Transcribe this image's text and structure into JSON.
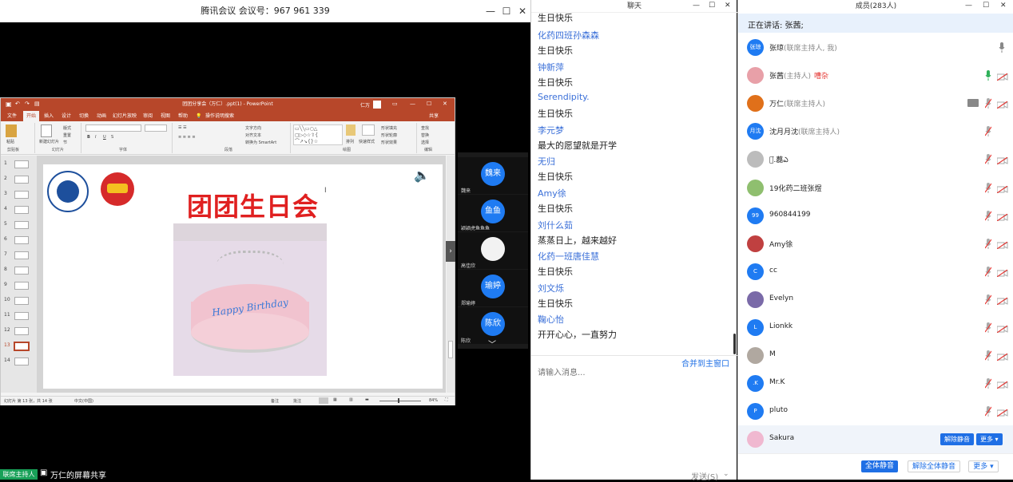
{
  "meeting": {
    "title": "腾讯会议 会议号：967 961 339",
    "window_controls": {
      "min": "—",
      "max": "☐",
      "close": "✕"
    },
    "host_badge": "联席主持人",
    "share_text": "万仁的屏幕共享"
  },
  "ppt": {
    "title": "团团分享会（万仁）.ppt(1) - PowerPoint",
    "user": "仁万",
    "tabs": [
      "文件",
      "开始",
      "插入",
      "设计",
      "切换",
      "动画",
      "幻灯片放映",
      "审阅",
      "视图",
      "帮助"
    ],
    "tell_me": "操作说明搜索",
    "share": "共享",
    "ribbon": {
      "paste": "粘贴",
      "new_slide": "新建幻灯片",
      "layout": "版式",
      "reset": "重置",
      "section": "节",
      "text_direction": "文字方向",
      "align_text": "对齐文本",
      "smartart": "转换为 SmartArt",
      "arrange": "排列",
      "quick_styles": "快速样式",
      "shape_fill": "形状填充",
      "shape_outline": "形状轮廓",
      "shape_effects": "形状效果",
      "find": "查找",
      "replace": "替换",
      "select": "选择",
      "groups": [
        "剪贴板",
        "幻灯片",
        "字体",
        "段落",
        "绘图",
        "编辑"
      ]
    },
    "thumbs": [
      "1",
      "2",
      "3",
      "4",
      "5",
      "6",
      "7",
      "8",
      "9",
      "10",
      "11",
      "12",
      "13",
      "14"
    ],
    "selected_thumb": "13",
    "slide_title": "团团生日会",
    "cake_text": "Happy Birthday",
    "status_left": "幻灯片 第 13 张，共 14 张",
    "status_lang": "中文(中国)",
    "status_notes": "备注",
    "status_comments": "批注",
    "zoom": "84%"
  },
  "video_strip": {
    "tiles": [
      {
        "avatar": "魏来",
        "name": "魏来"
      },
      {
        "avatar": "鱼鱼",
        "name": "颖颖虎鱼鱼鱼"
      },
      {
        "avatar": "",
        "name": "高佳欣"
      },
      {
        "avatar": "瑜婷",
        "name": "郑瑜婷"
      },
      {
        "avatar": "陈欣",
        "name": "陈欣"
      }
    ]
  },
  "chat": {
    "title": "聊天",
    "messages": [
      {
        "name": "",
        "text": "生日快乐"
      },
      {
        "name": "化药四班孙森森",
        "text": "生日快乐"
      },
      {
        "name": "钟新萍",
        "text": "生日快乐"
      },
      {
        "name": "Serendipity.",
        "text": "生日快乐"
      },
      {
        "name": "李元梦",
        "text": "最大的愿望就是开学"
      },
      {
        "name": "无归",
        "text": "生日快乐"
      },
      {
        "name": "Amy徐",
        "text": "生日快乐"
      },
      {
        "name": "刘什么茹",
        "text": "蒸蒸日上，越来越好"
      },
      {
        "name": "化药一班唐佳慧",
        "text": "生日快乐"
      },
      {
        "name": "刘文烁",
        "text": "生日快乐"
      },
      {
        "name": "鞠心怡",
        "text": "开开心心，一直努力"
      }
    ],
    "merge_link": "合并到主窗口",
    "input_placeholder": "请输入消息...",
    "send": "发送(S)"
  },
  "members": {
    "title": "成员(283人)",
    "speaking": "正在讲话: 张茜;",
    "list": [
      {
        "avatar": "张琼",
        "name": "张琼",
        "role": "(联席主持人, 我)",
        "noise": "",
        "mic": "on-gray",
        "cam": false,
        "color": "#1f7bf2"
      },
      {
        "avatar": "",
        "name": "张茜",
        "role": "(主持人)",
        "noise": "嘈杂",
        "mic": "on-green",
        "cam": "off",
        "color": "#e8a0a8"
      },
      {
        "avatar": "",
        "name": "万仁",
        "role": "(联席主持人)",
        "noise": "",
        "mic": "off",
        "cam": "off",
        "share": true,
        "color": "#e0701a"
      },
      {
        "avatar": "月沈",
        "name": "沈月月沈",
        "role": "(联席主持人)",
        "noise": "",
        "mic": "off",
        "cam": false,
        "color": "#1f7bf2"
      },
      {
        "avatar": "",
        "name": "ぃ͘.藞ఎ",
        "role": "",
        "noise": "",
        "mic": "off",
        "cam": "off",
        "color": "#bcbcbc"
      },
      {
        "avatar": "",
        "name": "19化药二班张煜",
        "role": "",
        "noise": "",
        "mic": "off",
        "cam": "off",
        "color": "#8fbf6f"
      },
      {
        "avatar": "99",
        "name": "960844199",
        "role": "",
        "noise": "",
        "mic": "off",
        "cam": "off",
        "color": "#1f7bf2"
      },
      {
        "avatar": "",
        "name": "Amy徐",
        "role": "",
        "noise": "",
        "mic": "off",
        "cam": "off",
        "color": "#c04040"
      },
      {
        "avatar": "C",
        "name": "cc",
        "role": "",
        "noise": "",
        "mic": "off",
        "cam": "off",
        "color": "#1f7bf2"
      },
      {
        "avatar": "",
        "name": "Evelyn",
        "role": "",
        "noise": "",
        "mic": "off",
        "cam": "off",
        "color": "#7a6aa8"
      },
      {
        "avatar": "L",
        "name": "Lionkk",
        "role": "",
        "noise": "",
        "mic": "off",
        "cam": "off",
        "color": "#1f7bf2"
      },
      {
        "avatar": "",
        "name": "M",
        "role": "",
        "noise": "",
        "mic": "off",
        "cam": "off",
        "color": "#b0a8a0"
      },
      {
        "avatar": ".K",
        "name": "Mr.K",
        "role": "",
        "noise": "",
        "mic": "off",
        "cam": "off",
        "color": "#1f7bf2"
      },
      {
        "avatar": "P",
        "name": "pluto",
        "role": "",
        "noise": "",
        "mic": "off",
        "cam": "off",
        "color": "#1f7bf2"
      },
      {
        "avatar": "",
        "name": "Sakura",
        "role": "",
        "noise": "",
        "mic": "",
        "cam": false,
        "hover": true,
        "color": "#f0b8d0"
      }
    ],
    "row_unmute": "解除静音",
    "row_more": "更多 ▾",
    "footer": {
      "mute_all": "全体静音",
      "unmute_all": "解除全体静音",
      "more": "更多 ▾"
    }
  }
}
